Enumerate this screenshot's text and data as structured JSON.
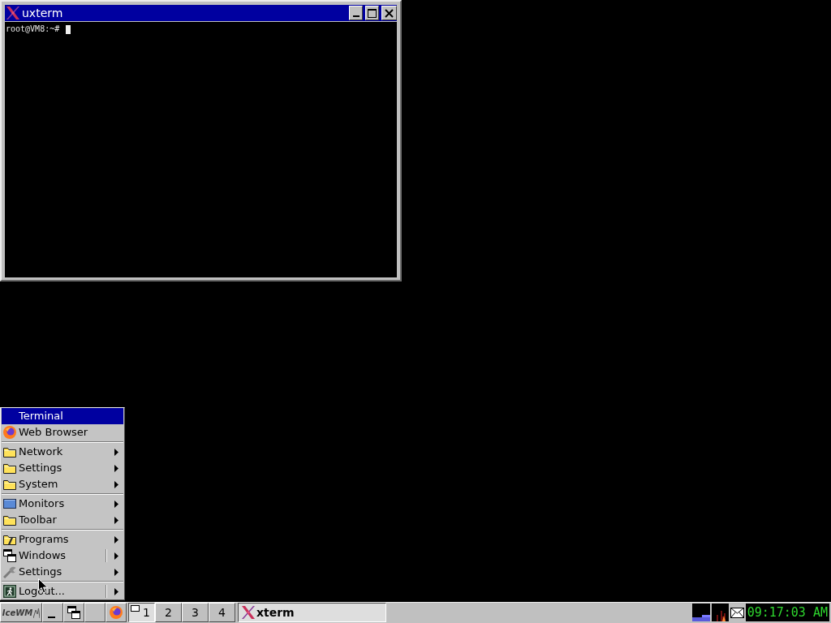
{
  "window": {
    "title": "uxterm",
    "terminal_lines": [
      "root@VM8:~#"
    ]
  },
  "menu": {
    "items": [
      {
        "kind": "plain",
        "label": "Terminal",
        "selected": true,
        "submenu": false,
        "split": false
      },
      {
        "kind": "browser",
        "label": "Web Browser",
        "selected": false,
        "submenu": false,
        "split": false
      },
      {
        "kind": "separator"
      },
      {
        "kind": "folder",
        "label": "Network",
        "selected": false,
        "submenu": true,
        "split": false
      },
      {
        "kind": "folder",
        "label": "Settings",
        "selected": false,
        "submenu": true,
        "split": false
      },
      {
        "kind": "folder",
        "label": "System",
        "selected": false,
        "submenu": true,
        "split": false
      },
      {
        "kind": "separator"
      },
      {
        "kind": "monitors",
        "label": "Monitors",
        "selected": false,
        "submenu": true,
        "split": false
      },
      {
        "kind": "folder",
        "label": "Toolbar",
        "selected": false,
        "submenu": true,
        "split": false
      },
      {
        "kind": "separator"
      },
      {
        "kind": "programs",
        "label": "Programs",
        "selected": false,
        "submenu": true,
        "split": false
      },
      {
        "kind": "windows",
        "label": "Windows",
        "selected": false,
        "submenu": true,
        "split": true
      },
      {
        "kind": "settings",
        "label": "Settings",
        "selected": false,
        "submenu": true,
        "split": false
      },
      {
        "kind": "separator"
      },
      {
        "kind": "logout",
        "label": "Logout...",
        "selected": false,
        "submenu": true,
        "split": true
      }
    ]
  },
  "taskbar": {
    "start_label": "IceWM",
    "quick_launch": [
      {
        "kind": "show-desktop"
      },
      {
        "kind": "window-list"
      },
      {
        "kind": "blank"
      },
      {
        "kind": "browser"
      }
    ],
    "workspaces": [
      {
        "label": "1",
        "selected": true
      },
      {
        "label": "2",
        "selected": false
      },
      {
        "label": "3",
        "selected": false
      },
      {
        "label": "4",
        "selected": false
      }
    ],
    "tasks": [
      {
        "label": "xterm",
        "selected": true
      }
    ],
    "clock": "09:17:03 AM"
  }
}
